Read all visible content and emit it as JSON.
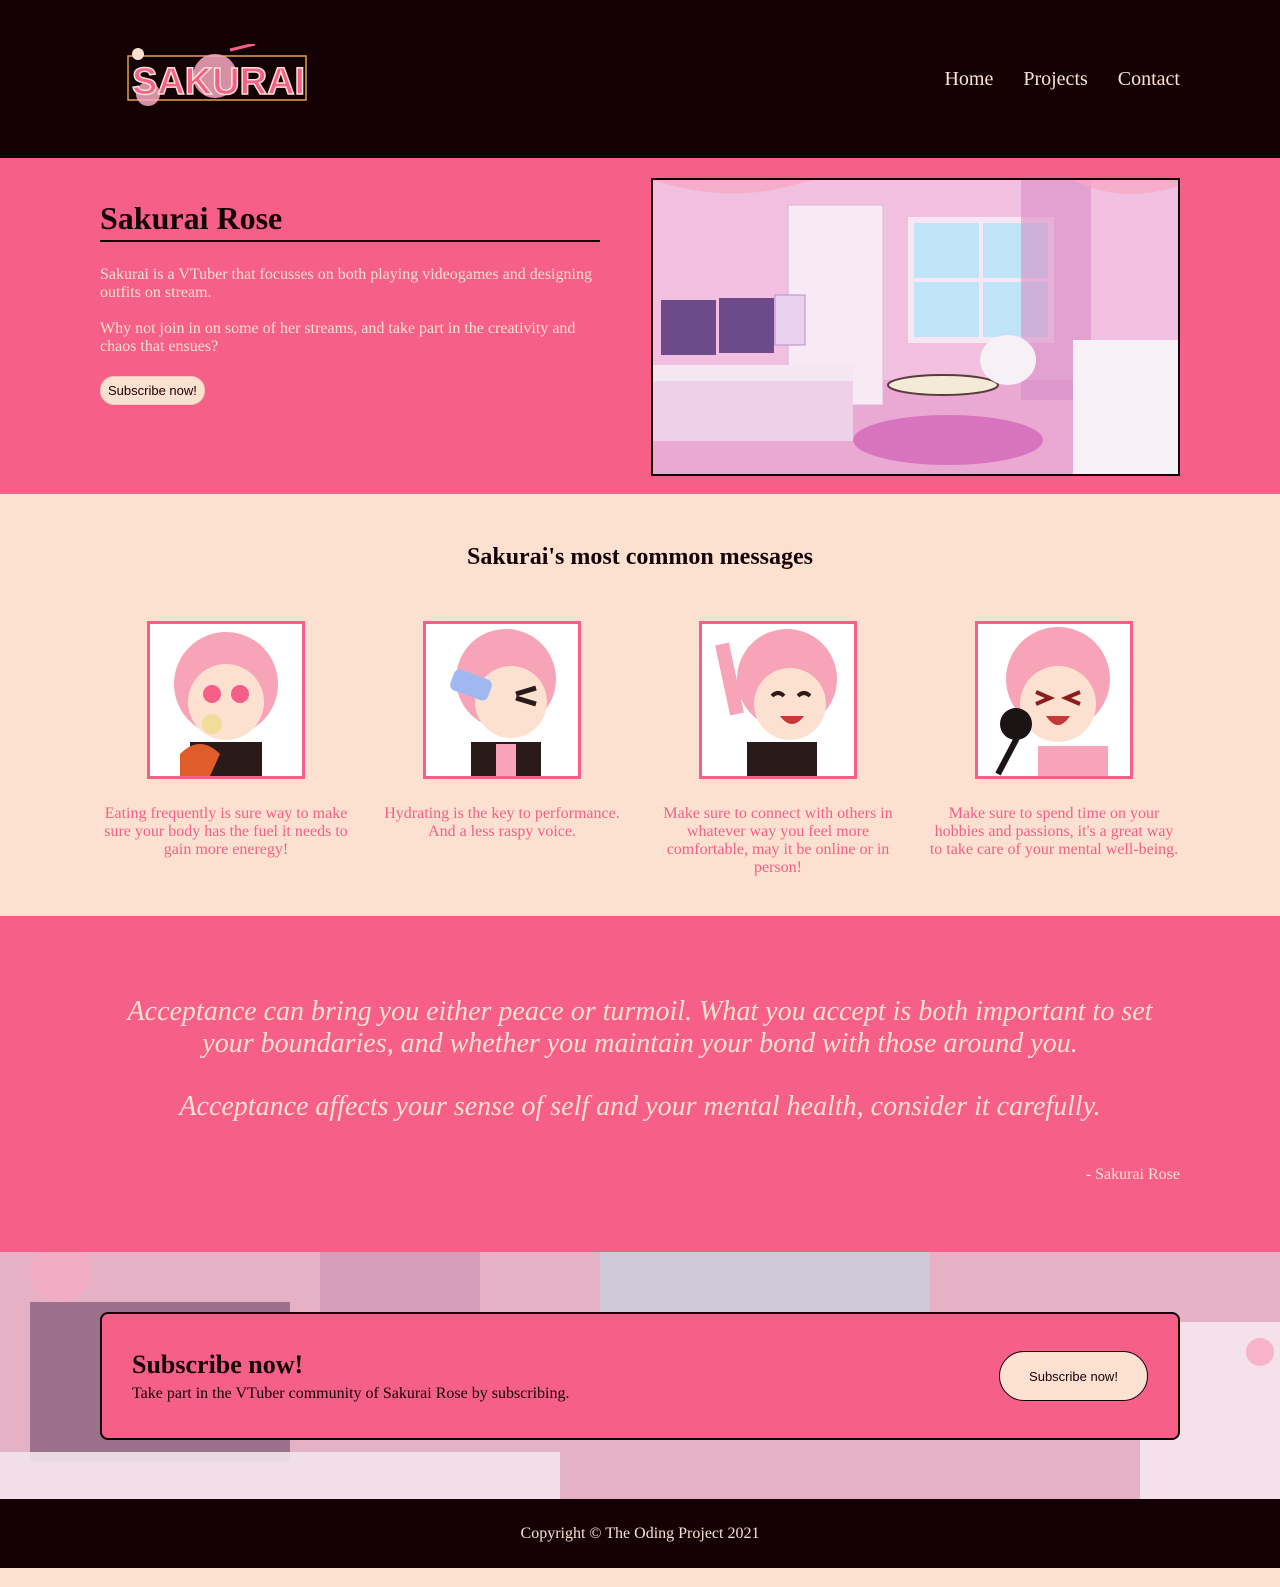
{
  "header": {
    "logo_text": "SAKURAI",
    "nav": [
      "Home",
      "Projects",
      "Contact"
    ]
  },
  "hero": {
    "title": "Sakurai Rose",
    "paragraphs": [
      "Sakurai is a VTuber that focusses on both playing videogames and designing outfits on stream.",
      "Why not join in on some of her streams, and take part in the creativity and chaos that ensues?"
    ],
    "button_label": "Subscribe now!"
  },
  "messages": {
    "title": "Sakurai's most common messages",
    "cards": [
      {
        "icon": "eating-emote-icon",
        "text": "Eating frequently is sure way to make sure your body has the fuel it needs to gain more eneregy!"
      },
      {
        "icon": "drinking-emote-icon",
        "text": "Hydrating is the key to performance. And a less raspy voice."
      },
      {
        "icon": "waving-emote-icon",
        "text": "Make sure to connect with others in whatever way you feel more comfortable, may it be online or in person!"
      },
      {
        "icon": "singing-emote-icon",
        "text": "Make sure to spend time on your hobbies and passions, it's a great way to take care of your mental well-being."
      }
    ]
  },
  "quote": {
    "paragraphs": [
      "Acceptance can bring you either peace or turmoil. What you accept is both important to set your boundaries, and whether you maintain your bond with those around you.",
      "Acceptance affects your sense of self and your mental health, consider it carefully."
    ],
    "author": "- Sakurai Rose"
  },
  "cta": {
    "title": "Subscribe now!",
    "subtitle": "Take part in the VTuber community of Sakurai Rose by subscribing.",
    "button_label": "Subscribe now!"
  },
  "footer": {
    "copyright": "Copyright © The Oding Project 2021"
  },
  "colors": {
    "dark": "#140105",
    "pink": "#f65f87",
    "cream": "#fde1d0"
  }
}
